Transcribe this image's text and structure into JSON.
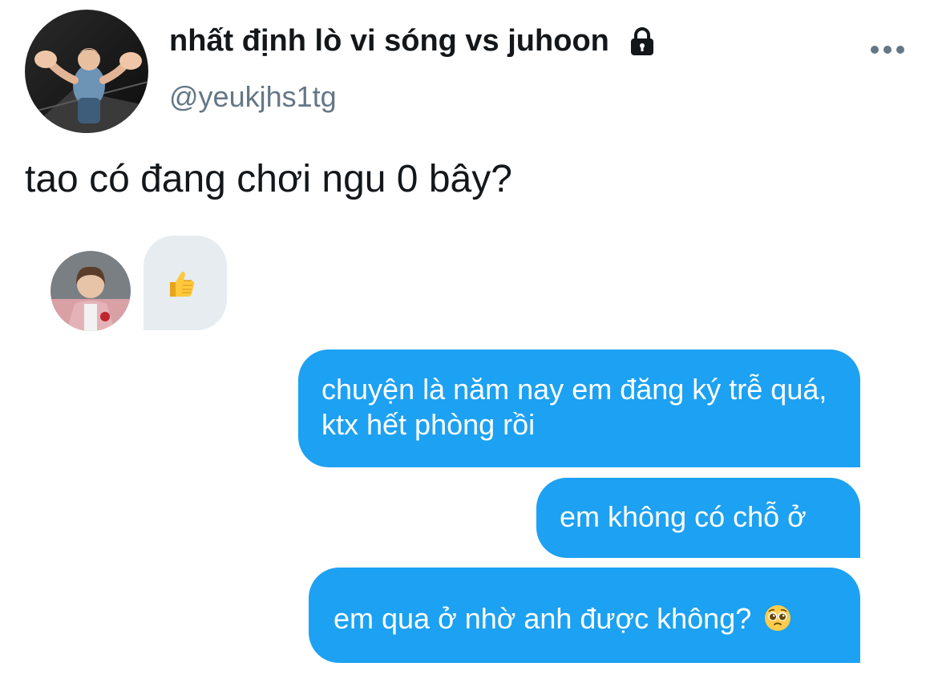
{
  "tweet": {
    "display_name": "nhất định lò vi sóng vs juhoon",
    "handle": "@yeukjhs1tg",
    "text": "tao có đang chơi ngu 0 bây?",
    "icons": {
      "lock": "lock-icon",
      "more": "more-options-icon",
      "avatar": "avatar"
    }
  },
  "chat": {
    "received": {
      "emoji": "thumbs-up"
    },
    "sent": [
      {
        "text": "chuyện là năm nay em đăng ký trễ quá, ktx hết phòng rồi"
      },
      {
        "text": "em không có chỗ ở"
      },
      {
        "text": "em qua ở nhờ anh được không?",
        "emoji": "pleading-face"
      }
    ]
  },
  "colors": {
    "accent": "#1da1f2",
    "received_bubble": "#e6ecf0",
    "text_primary": "#14171a",
    "text_secondary": "#657786"
  }
}
